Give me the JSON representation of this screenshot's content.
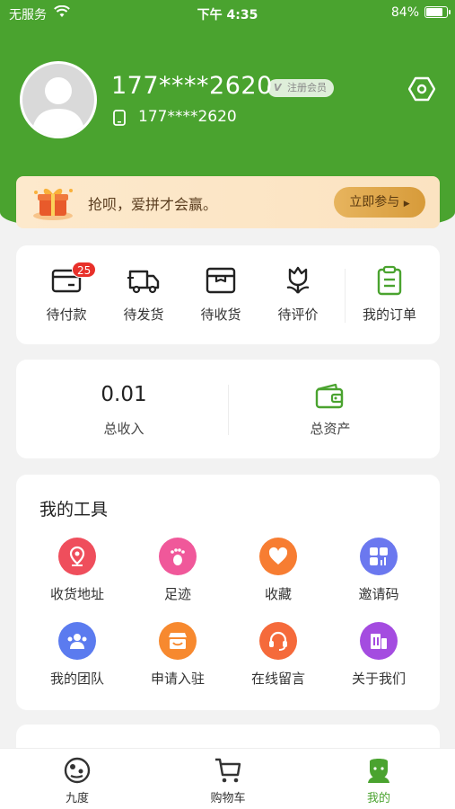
{
  "status_bar": {
    "carrier": "无服务",
    "time": "下午 4:35",
    "battery_text": "84%",
    "battery_level": 0.84
  },
  "profile": {
    "phone_masked": "177****2620",
    "member_badge": "注册会员",
    "phone_secondary": "177****2620"
  },
  "banner": {
    "text": "抢呗，爱拼才会赢。",
    "button": "立即参与"
  },
  "orders": {
    "items": [
      {
        "label": "待付款",
        "icon": "wallet-card-icon",
        "badge": "25"
      },
      {
        "label": "待发货",
        "icon": "truck-icon"
      },
      {
        "label": "待收货",
        "icon": "box-icon"
      },
      {
        "label": "待评价",
        "icon": "tulip-icon"
      },
      {
        "label": "我的订单",
        "icon": "clipboard-icon"
      }
    ]
  },
  "assets": {
    "income_value": "0.01",
    "income_label": "总收入",
    "total_assets_label": "总资产"
  },
  "tools": {
    "title": "我的工具",
    "items": [
      {
        "label": "收货地址",
        "icon": "location-icon",
        "color": "#ef4e5c"
      },
      {
        "label": "足迹",
        "icon": "footprint-icon",
        "color": "#f0589a"
      },
      {
        "label": "收藏",
        "icon": "heart-icon",
        "color": "#f77d32"
      },
      {
        "label": "邀请码",
        "icon": "grid-icon",
        "color": "#6b78ef"
      },
      {
        "label": "我的团队",
        "icon": "team-icon",
        "color": "#5b7bef"
      },
      {
        "label": "申请入驻",
        "icon": "shop-icon",
        "color": "#f7892f"
      },
      {
        "label": "在线留言",
        "icon": "headset-icon",
        "color": "#f56a3b"
      },
      {
        "label": "关于我们",
        "icon": "building-icon",
        "color": "#a44ce0"
      }
    ]
  },
  "tabbar": {
    "items": [
      {
        "label": "九度",
        "icon": "home-icon"
      },
      {
        "label": "购物车",
        "icon": "cart-icon"
      },
      {
        "label": "我的",
        "icon": "profile-icon",
        "active": true
      }
    ]
  },
  "colors": {
    "brand_green": "#4aa32f",
    "badge_red": "#e8302a"
  }
}
